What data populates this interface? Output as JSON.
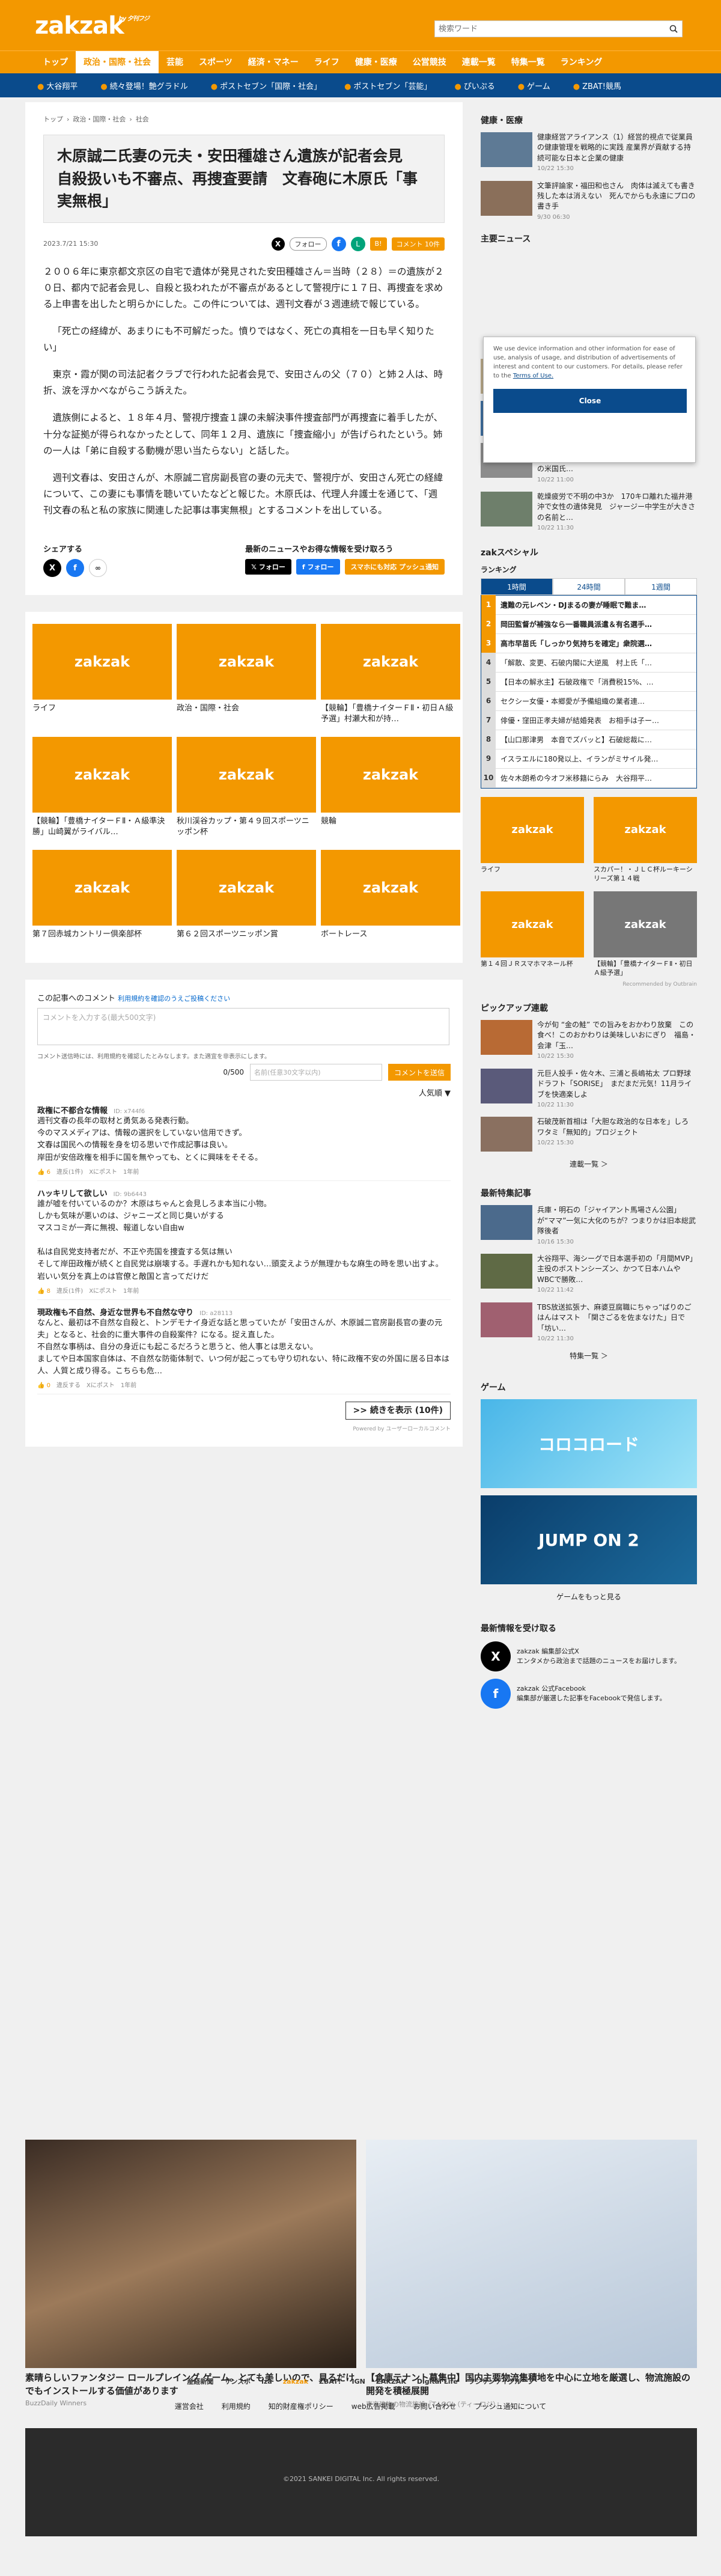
{
  "header": {
    "logo": "zakzak",
    "logo_tag": "by 夕刊フジ",
    "search_placeholder": "検索ワード"
  },
  "gnav": [
    "トップ",
    "政治・国際・社会",
    "芸能",
    "スポーツ",
    "経済・マネー",
    "ライフ",
    "健康・医療",
    "公営競技",
    "連載一覧",
    "特集一覧",
    "ランキング"
  ],
  "subnav": [
    "大谷翔平",
    "続々登場！艶グラドル",
    "ポストセブン「国際・社会」",
    "ポストセブン「芸能」",
    "ぴいぷる",
    "ゲーム",
    "ZBAT!競馬"
  ],
  "breadcrumb": [
    "トップ",
    "政治・国際・社会",
    "社会"
  ],
  "article": {
    "title": "木原誠二氏妻の元夫・安田種雄さん遺族が記者会見　自殺扱いも不審点、再捜査要請　文春砲に木原氏「事実無根」",
    "date": "2023.7/21 15:30",
    "follow_label": "フォロー",
    "hatena": "B!",
    "comment_pill": "コメント 10件",
    "paragraphs": [
      "２００６年に東京都文京区の自宅で遺体が発見された安田種雄さん＝当時（２８）＝の遺族が２０日、都内で記者会見し、自殺と扱われたが不審点があるとして警視庁に１７日、再捜査を求める上申書を出したと明らかにした。この件については、週刊文春が３週連続で報じている。",
      "「死亡の経緯が、あまりにも不可解だった。憤りではなく、死亡の真相を一日も早く知りたい」",
      "東京・霞が関の司法記者クラブで行われた記者会見で、安田さんの父（７０）と姉２人は、時折、涙を浮かべながらこう訴えた。",
      "遺族側によると、１８年４月、警視庁捜査１課の未解決事件捜査部門が再捜査に着手したが、十分な証拠が得られなかったとして、同年１２月、遺族に「捜査縮小」が告げられたという。姉の一人は「弟に自殺する動機が思い当たらない」と話した。",
      "週刊文春は、安田さんが、木原誠二官房副長官の妻の元夫で、警視庁が、安田さん死亡の経緯について、この妻にも事情を聴いていたなどと報じた。木原氏は、代理人弁護士を通じて、「週刊文春の私と私の家族に関連した記事は事実無根」とするコメントを出している。"
    ]
  },
  "share": {
    "label": "シェアする",
    "news_label": "最新のニュースやお得な情報を受け取ろう",
    "follow_x": "フォロー",
    "follow_fb": "フォロー",
    "push": "スマホにも対応 プッシュ通知"
  },
  "related": [
    {
      "caption": "ライフ"
    },
    {
      "caption": "政治・国際・社会"
    },
    {
      "caption": "【競輪】「豊橋ナイターＦⅡ・初日Ａ級予選」村瀬大和が持…"
    },
    {
      "caption": "【競輪】「豊橋ナイターＦⅡ・Ａ級準決勝」山崎翼がライバル…"
    },
    {
      "caption": "秋川渓谷カップ・第４９回スポーツニッポン杯"
    },
    {
      "caption": "競輪"
    },
    {
      "caption": "第７回赤城カントリー倶楽部杯"
    },
    {
      "caption": "第６２回スポーツニッポン賞"
    },
    {
      "caption": "ボートレース"
    }
  ],
  "related_thumb": "zakzak",
  "comments": {
    "heading": "この記事へのコメント",
    "guideline": "利用規約を確認のうえご投稿ください",
    "placeholder": "コメントを入力する(最大500文字)",
    "note": "コメント送信時には、利用規約を確認したとみなします。また適宜を非表示にします。",
    "count": "0/500",
    "nick_placeholder": "名前(任意30文字以内)",
    "send": "コメントを送信",
    "sort": "人気順 ▼",
    "items": [
      {
        "title": "政権に不都合な情報",
        "id": "ID: x744f6",
        "text": "週刊文春の長年の取材と勇気ある発表行動。\n今のマスメディアは、情報の選択をしていない信用できず。\n文春は国民への情報を身を切る思いで作成記事は良い。\n岸田が安倍政権を相手に国を無やっても、とくに興味をそそる。",
        "likes": "6",
        "good": "違反(1件)",
        "share": "Xにポスト",
        "ago": "1年前"
      },
      {
        "title": "ハッキリして欲しい",
        "id": "ID: 9b6443",
        "text": "誰が嘘を付いているのか？木原はちゃんと会見しろま本当に小物。\nしかも気味が悪いのは、ジャニーズと同じ臭いがする\nマスコミが一斉に無視、報道しない自由w\n\n私は自民党支持者だが、不正や売国を捜査する気は無い\nそして岸田政権が続くと自民党は崩壊する。手遅れかも知れない…頭変えようが無理かもな麻生の時を思い出すよ。岩いい気分を真上のは官僚と敵国と言ってだけだ",
        "likes": "8",
        "good": "違反(1件)",
        "share": "Xにポスト",
        "ago": "1年前"
      },
      {
        "title": "現政権も不自然、身近な世界も不自然な守り",
        "id": "ID: a28113",
        "text": "なんと、最初は不自然な自殺と、トンデモナイ身近な話と思っていたが「安田さんが、木原誠二官房副長官の妻の元夫」となると、社会的に重大事件の自殺案件？になる。捉え直した。\n不自然な事柄は、自分の身近にも起こるだろうと思うと、他人事とは思えない。\nましてや日本国家自体は、不自然な防衛体制で、いつ何が起こっても守り切れない、特に政権不安の外国に居る日本は人、人質と成り得る。こちらも危…",
        "likes": "0",
        "good": "違反する",
        "share": "Xにポスト",
        "ago": "1年前"
      }
    ],
    "more_inline": "続きを表示",
    "more": ">> 続きを表示 (10件)",
    "powered": "Powered by ユーザーローカルコメント"
  },
  "sidebar": {
    "health_heading": "健康・医療",
    "health": [
      {
        "text": "健康経営アライアンス（1）経営的視点で従業員の健康管理を戦略的に実践 産業界が貢献する持続可能な日本と企業の健康",
        "time": "10/22 15:30"
      },
      {
        "text": "文筆評論家・福田和也さん　肉体は滅えても書き残した本は消えない　死んでからも永遠にプロの書き手",
        "time": "9/30 06:30"
      }
    ],
    "main_news_heading": "主要ニュース",
    "main_news": [
      {
        "text": "「解散、変更」石破内閣に大逆風　対…",
        "time": ""
      },
      {
        "text": "国は日本のエネルギーを狙う　…",
        "time": "10/22 11:00"
      },
      {
        "text": "新知事は中国に「支援すべきは支援する」柏の棚の上の外交を　海自護衛艦「甘美海峡通過」決断の米国氏…",
        "time": "10/22 11:00"
      },
      {
        "text": "乾燥疲労で不明の中3か　170キロ離れた福井港沖で女性の遺体発見　ジャージー中学生が大きさの名前と…",
        "time": "10/22 11:30"
      }
    ],
    "cookie_text": "We use device information and other information for ease of use, analysis of usage, and distribution of advertisements of interest and content to our customers. For details, please refer to the ",
    "cookie_link": "Terms of Use.",
    "cookie_close": "Close",
    "zakspecial": "zakスペシャル",
    "ranking_heading": "ランキング",
    "ranking_tabs": [
      "1時間",
      "24時間",
      "1週間"
    ],
    "ranking": [
      "遺難の元レベン・DJまるの妻が睡眠で難ま…",
      "岡田監督が補強なら一番職員派遣＆有名選手…",
      "高市早苗氏「しっかり気持ちを確定」衆院選…",
      "「解散、変更、石破内閣に大逆風　村上氏「…",
      "【日本の解氷主】石破政権で「消費税15%、…",
      "セクシー女優・本郷愛が予備組織の業者連…",
      "俳優・窪田正孝夫婦が結婚発表　お相手は子ー…",
      "【山口那津男　本音でズバッと】石破総裁に…",
      "イスラエルに180発以上、イランがミサイル発…",
      "佐々木朗希の今オフ米移籍にらみ　大谷翔平…"
    ],
    "side_grid": [
      {
        "caption": "ライフ"
      },
      {
        "caption": "スカパー！・ＪＬＣ杯ルーキーシリーズ第１４戦"
      },
      {
        "caption": "第１４回ＪＲスマホマネール杯"
      },
      {
        "caption": "【競輪】「豊橋ナイターＦⅡ・初日Ａ級予選」"
      }
    ],
    "recommended": "Recommended by Outbrain",
    "pickup_heading": "ピックアップ連載",
    "pickup": [
      {
        "text": "今が旬 “金の鮭” での旨みをおかわり放棄　この食べ！このおかわりは美味しいおにぎり　福島・会津「玉…",
        "time": "10/22 15:30"
      },
      {
        "text": "元巨人投手・佐々木、三浦と長嶋祐太 プロ野球ドラフト「SORISE」　まだまだ元気！11月ライブを快適楽しよ",
        "time": "10/22 11:30"
      },
      {
        "text": "石破茂新首相は「大胆な政治的な日本を」しろ　ワタミ「無知的」プロジェクト",
        "time": "10/22 15:30"
      }
    ],
    "pickup_more": "連載一覧 ＞",
    "feature_heading": "最新特集記事",
    "features": [
      {
        "text": "兵庫・明石の「ジャイアント馬場さん公園」が“ママ”一気に大化のちが？つまりかは旧本総武隊後者",
        "time": "10/16 15:30"
      },
      {
        "text": "大谷翔平、海シーグで日本選手初の「月間MVP」主役のボストンシーズン、かつて日本ハムやWBCで勝敗…",
        "time": "10/22 11:42"
      },
      {
        "text": "TBS放送拡張ナ、麻婆豆腐職にちゃっ“ばりのごはんはマスト　「関さごるを佐まなけた」日で「坊い…",
        "time": "10/22 11:30"
      }
    ],
    "feature_more": "特集一覧 ＞",
    "game_heading": "ゲーム",
    "games": [
      "コロコロード",
      "JUMP ON 2"
    ],
    "game_more": "ゲームをもっと見る",
    "follow_heading": "最新情報を受け取る",
    "follow": [
      {
        "name": "zakzak 編集部公式X",
        "text": "エンタメから政治まで話題のニュースをお届けします。"
      },
      {
        "name": "zakzak 公式Facebook",
        "text": "編集部が厳選した記事をFacebookで発信します。"
      }
    ]
  },
  "ads": [
    {
      "title": "素晴らしいファンタジー ロールプレイング ゲーム。とても美しいので、見るだけでもインストールする価値があります",
      "source": "BuzzDaily Winners"
    },
    {
      "title": "【倉庫テナント募集中】国内主要物流集積地を中心に立地を厳選し、物流施設の開発を積極展開",
      "source": "東京建物の物流施設『T-LOGI（ティーロジ）』"
    }
  ],
  "partners": [
    "産経新聞",
    "サンスポ",
    "iza",
    "zakzak",
    "ZBAT!",
    "IGN",
    "ZAKZAK",
    "Digital Life",
    "フジサンケイグループ"
  ],
  "footer_links": [
    "運営会社",
    "利用規約",
    "知的財産権ポリシー",
    "web広告掲載",
    "お問い合わせ",
    "プッシュ通知について"
  ],
  "copyright": "©2021 SANKEI DIGITAL Inc. All rights reserved.",
  "colors": {
    "brand_orange": "#f39800",
    "navy": "#0a4b8c"
  }
}
